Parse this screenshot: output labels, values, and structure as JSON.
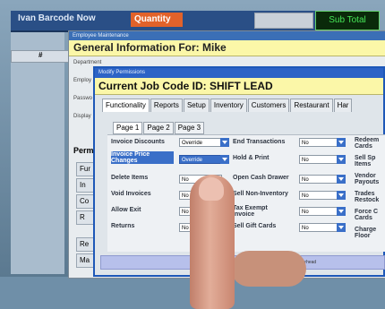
{
  "pos": {
    "title": "Ivan Barcode Now",
    "quantity_label": "Quantity",
    "subtotal_label": "Sub Total",
    "grid_header": "#"
  },
  "employee_window": {
    "titlebar": "Employee Maintenance",
    "header": "General Information For: Mike",
    "fields": [
      "Department",
      "Employ",
      "Passwo",
      "Display"
    ],
    "permissions_label": "Perm",
    "buttons": [
      "Fur",
      "In",
      "Co",
      "R",
      "Re",
      "Ma"
    ]
  },
  "perm_window": {
    "titlebar": "Modify Permissions",
    "header": "Current Job Code ID: SHIFT LEAD",
    "tabs": [
      "Functionality",
      "Reports",
      "Setup",
      "Inventory",
      "Customers",
      "Restaurant",
      "Har"
    ],
    "active_tab": "Functionality",
    "subtabs": [
      "Page 1",
      "Page 2",
      "Page 3"
    ],
    "col1": [
      {
        "label": "Invoice Discounts",
        "value": "Override"
      },
      {
        "label": "Invoice Price Changes",
        "value": "Override"
      },
      {
        "label": "Delete Items",
        "value": "No"
      },
      {
        "label": "Void Invoices",
        "value": "No"
      },
      {
        "label": "Allow Exit",
        "value": "No"
      },
      {
        "label": "Returns",
        "value": "No"
      }
    ],
    "col2": [
      {
        "label": "End Transactions",
        "value": "No"
      },
      {
        "label": "Hold & Print",
        "value": "No"
      },
      {
        "label": "Open Cash Drawer",
        "value": "No"
      },
      {
        "label": "Sell Non-Inventory",
        "value": "No"
      },
      {
        "label": "Tax Exempt Invoice",
        "value": "No"
      },
      {
        "label": "Sell Gift Cards",
        "value": "No"
      }
    ],
    "col3": [
      "Redeem Cards",
      "Sell Sp Items",
      "Vendor Payouts",
      "Trades Restock",
      "Force C Cards",
      "Charge Floor"
    ],
    "footer_text": "Allow Non-Ink Overhead"
  }
}
